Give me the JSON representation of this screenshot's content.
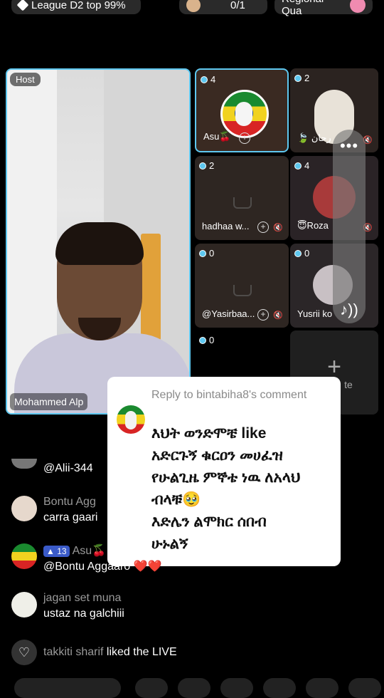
{
  "top_bar": {
    "league": "League D2 top 99%",
    "counter": "0/1",
    "regional": "Regional Qua"
  },
  "host": {
    "tag": "Host",
    "name": "Mohammed Alp"
  },
  "guests": [
    {
      "count": "4",
      "name": "Asu🍒"
    },
    {
      "count": "2",
      "name": "🍃 رحان"
    },
    {
      "count": "2",
      "name": "hadhaa w..."
    },
    {
      "count": "4",
      "name": "😇Roza"
    },
    {
      "count": "0",
      "name": "@Yasirbaa..."
    },
    {
      "count": "0",
      "name": "Yusrii ko"
    },
    {
      "count": "0",
      "name": ""
    }
  ],
  "add_tile": {
    "plus": "+",
    "label": "te"
  },
  "side_panel": {
    "dots": "•••",
    "music": "♪))"
  },
  "reply_popup": {
    "reply_to": "Reply to bintabiha8's comment",
    "line1": "እህት ወንድሞቼ like",
    "line2": "አድርጉኝ ቁርዐን መሀፈዝ",
    "line3": "የሁልጊዜ ምኞቴ ነዉ ለአላህ",
    "line4": "ብላቹ🥹",
    "line5": "እድሌን ልሞክር ሰበብ",
    "line6": "ሁኑልኝ"
  },
  "comments": [
    {
      "user": "",
      "msg": "@Alii-344"
    },
    {
      "user": "Bontu Agg",
      "msg": "carra gaari"
    },
    {
      "badge": "13",
      "user": "Asu🍒",
      "msg": "@Bontu Aggaaro ❤️❤️"
    },
    {
      "user": "jagan set muna",
      "msg": "ustaz na galchiii"
    }
  ],
  "liked": {
    "user": "takkiti sharif",
    "action": "liked the LIVE"
  }
}
